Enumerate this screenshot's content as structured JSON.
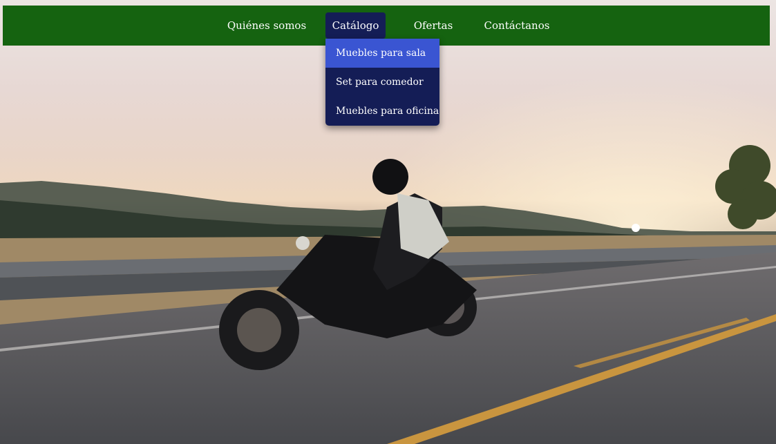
{
  "nav": {
    "items": [
      {
        "label": "Quiénes somos"
      },
      {
        "label": "Catálogo"
      },
      {
        "label": "Ofertas"
      },
      {
        "label": "Contáctanos"
      }
    ],
    "active_index": 1
  },
  "dropdown": {
    "items": [
      {
        "label": "Muebles para sala"
      },
      {
        "label": "Set para comedor"
      },
      {
        "label": "Muebles para oficina"
      }
    ],
    "highlighted_index": 0
  },
  "colors": {
    "navbar": "#156310",
    "active_item": "#141d56",
    "dropdown": "#141d56",
    "dropdown_highlight": "#3a55d2",
    "text": "#ffffff"
  }
}
